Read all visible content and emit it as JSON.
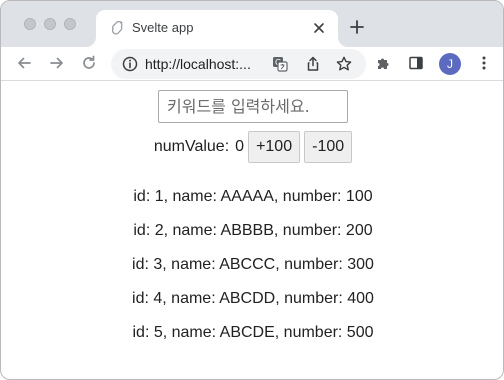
{
  "browser": {
    "tab": {
      "title": "Svelte app",
      "favicon": "svelte-icon",
      "close_icon": "close-icon"
    },
    "new_tab_icon": "plus-icon",
    "toolbar": {
      "back_icon": "arrow-left-icon",
      "forward_icon": "arrow-right-icon",
      "reload_icon": "reload-icon",
      "address": "http://localhost:...",
      "site_info_icon": "info-icon",
      "translate_icon": "translate-icon",
      "share_icon": "share-icon",
      "bookmark_icon": "star-icon",
      "extensions_icon": "puzzle-icon",
      "side_panel_icon": "side-panel-icon",
      "profile_initial": "J",
      "profile_color": "#5c6bc0",
      "menu_icon": "more-vert-icon"
    }
  },
  "page": {
    "search": {
      "placeholder": "키워드를 입력하세요.",
      "value": ""
    },
    "counter": {
      "label": "numValue:",
      "value": "0",
      "plus_label": "+100",
      "minus_label": "-100"
    },
    "items": [
      "id: 1, name: AAAAA, number: 100",
      "id: 2, name: ABBBB, number: 200",
      "id: 3, name: ABCCC, number: 300",
      "id: 4, name: ABCDD, number: 400",
      "id: 5, name: ABCDE, number: 500"
    ]
  }
}
